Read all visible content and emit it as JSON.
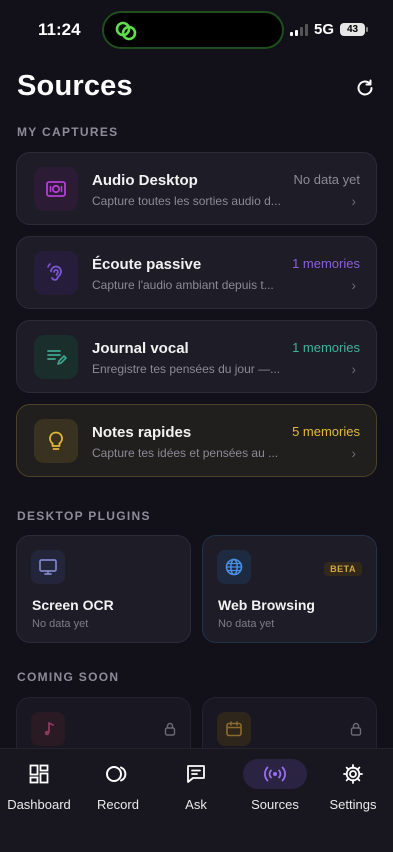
{
  "status_bar": {
    "time": "11:24",
    "network": "5G",
    "battery": "43"
  },
  "header": {
    "title": "Sources"
  },
  "sections": {
    "my_captures": "MY CAPTURES",
    "desktop_plugins": "DESKTOP PLUGINS",
    "coming_soon": "COMING SOON"
  },
  "captures": [
    {
      "title": "Audio Desktop",
      "description": "Capture toutes les sorties audio d...",
      "status": "No data yet",
      "status_color": "#8b8a95",
      "icon": "speaker-icon",
      "accent": "#a23ac4"
    },
    {
      "title": "Écoute passive",
      "description": "Capture l'audio ambiant depuis t...",
      "status": "1 memories",
      "status_color": "#8e5ed9",
      "icon": "ear-icon",
      "accent": "#7b56d6"
    },
    {
      "title": "Journal vocal",
      "description": "Enregistre tes pensées du jour —...",
      "status": "1 memories",
      "status_color": "#3fb39a",
      "icon": "journal-pen-icon",
      "accent": "#3fa690"
    },
    {
      "title": "Notes rapides",
      "description": "Capture tes idées et pensées au ...",
      "status": "5 memories",
      "status_color": "#e6b93c",
      "icon": "lightbulb-icon",
      "accent": "#e6b93c"
    }
  ],
  "plugins": [
    {
      "title": "Screen OCR",
      "subtitle": "No data yet",
      "icon": "monitor-icon"
    },
    {
      "title": "Web Browsing",
      "subtitle": "No data yet",
      "icon": "globe-icon",
      "badge": "BETA"
    }
  ],
  "coming_soon": [
    {
      "icon": "music-note-icon"
    },
    {
      "icon": "calendar-icon"
    }
  ],
  "tabs": [
    {
      "label": "Dashboard",
      "icon": "dashboard-icon"
    },
    {
      "label": "Record",
      "icon": "record-icon"
    },
    {
      "label": "Ask",
      "icon": "chat-icon"
    },
    {
      "label": "Sources",
      "icon": "broadcast-icon",
      "active": true
    },
    {
      "label": "Settings",
      "icon": "gear-icon"
    }
  ]
}
